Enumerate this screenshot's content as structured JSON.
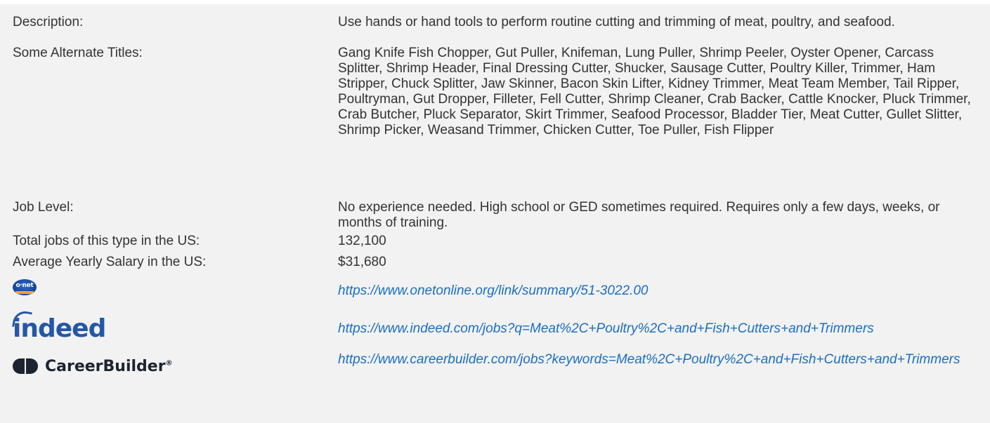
{
  "rows": [
    {
      "label": "Description:",
      "value": "Use hands or hand tools to perform routine cutting and trimming of meat, poultry, and seafood."
    },
    {
      "label": "Some Alternate Titles:",
      "value": "Gang Knife Fish Chopper, Gut Puller, Knifeman, Lung Puller, Shrimp Peeler, Oyster Opener, Carcass Splitter, Shrimp Header, Final Dressing Cutter, Shucker, Sausage Cutter, Poultry Killer, Trimmer, Ham Stripper, Chuck Splitter, Jaw Skinner, Bacon Skin Lifter, Kidney Trimmer, Meat Team Member, Tail Ripper, Poultryman, Gut Dropper, Filleter, Fell Cutter, Shrimp Cleaner, Crab Backer, Cattle Knocker, Pluck Trimmer, Crab Butcher, Pluck Separator, Skirt Trimmer, Seafood Processor, Bladder Tier, Meat Cutter, Gullet Slitter, Shrimp Picker, Weasand Trimmer, Chicken Cutter, Toe Puller, Fish Flipper"
    },
    {
      "label": "Job Level:",
      "value": "No experience needed. High school or GED sometimes required. Requires only a few days, weeks, or months of training."
    },
    {
      "label": "Total jobs of this type in the US:",
      "value": "132,100"
    },
    {
      "label": "Average Yearly Salary in the US:",
      "value": "$31,680"
    }
  ],
  "links": {
    "onet": {
      "logo_text": "o·net",
      "logo_icon": "onet-logo",
      "url": "https://www.onetonline.org/link/summary/51-3022.00"
    },
    "indeed": {
      "logo_text": "indeed",
      "logo_icon": "indeed-logo",
      "url": "https://www.indeed.com/jobs?q=Meat%2C+Poultry%2C+and+Fish+Cutters+and+Trimmers"
    },
    "careerbuilder": {
      "logo_text": "CareerBuilder",
      "logo_icon": "careerbuilder-logo",
      "url": "https://www.careerbuilder.com/jobs?keywords=Meat%2C+Poultry%2C+and+Fish+Cutters+and+Trimmers"
    }
  },
  "colors": {
    "background": "#f2f2f2",
    "text": "#333333",
    "link": "#1a6fc2",
    "indeed_blue": "#2557a7",
    "onet_blue": "#123f93",
    "onet_orange": "#f5a623",
    "careerbuilder_dark": "#1c2430"
  }
}
